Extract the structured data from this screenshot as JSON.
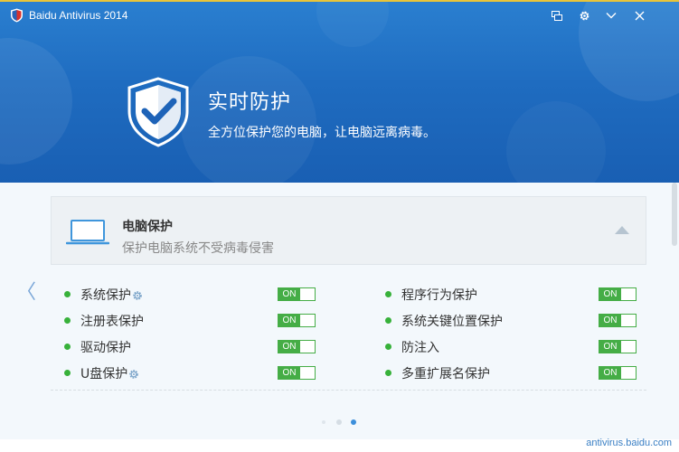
{
  "window": {
    "title": "Baidu Antivirus 2014"
  },
  "hero": {
    "title": "实时防护",
    "subtitle": "全方位保护您的电脑，让电脑远离病毒。"
  },
  "card": {
    "title": "电脑保护",
    "description": "保护电脑系统不受病毒侵害"
  },
  "protections": {
    "left": [
      {
        "label": "系统保护",
        "state": "ON",
        "has_settings": true
      },
      {
        "label": "注册表保护",
        "state": "ON",
        "has_settings": false
      },
      {
        "label": "驱动保护",
        "state": "ON",
        "has_settings": false
      },
      {
        "label": "U盘保护",
        "state": "ON",
        "has_settings": true
      }
    ],
    "right": [
      {
        "label": "程序行为保护",
        "state": "ON"
      },
      {
        "label": "系统关键位置保护",
        "state": "ON"
      },
      {
        "label": "防注入",
        "state": "ON"
      },
      {
        "label": "多重扩展名保护",
        "state": "ON"
      }
    ]
  },
  "pager": {
    "page_count": 3,
    "active_page": 3
  },
  "footer": {
    "link": "antivirus.baidu.com"
  },
  "colors": {
    "header_blue": "#1f6cc0",
    "accent_green": "#45ad46",
    "status_dot_green": "#37b13a",
    "active_pager": "#3c8fdb",
    "link": "#3a7fc4"
  },
  "icons": {
    "app_logo": "baidu-antivirus-logo-icon",
    "hero": "shield-check-icon",
    "card": "laptop-icon",
    "settings": "gear-icon",
    "skin": "skin-icon",
    "menu": "chevron-down-icon",
    "close": "close-icon",
    "prev": "chevron-left-icon",
    "collapse": "triangle-up-icon"
  }
}
